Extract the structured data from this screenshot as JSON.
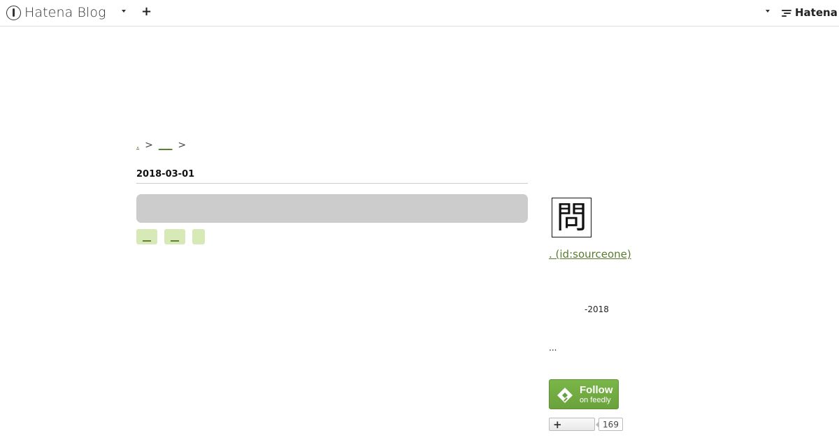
{
  "navbar": {
    "brand": "Hatena Blog",
    "add_icon": "plus-icon",
    "hatena": "Hatena"
  },
  "breadcrumb": {
    "home": ".",
    "separator": ">",
    "category": "___"
  },
  "entry": {
    "date": "2018-03-01",
    "tags": [
      "__",
      "__",
      ""
    ]
  },
  "sidebar": {
    "profile_icon_char": "問",
    "profile_link": ". (id:sourceone)",
    "year": "-2018",
    "ellipsis": "..."
  },
  "feedly": {
    "title": "Follow",
    "subtitle": "on feedly"
  },
  "bookmark": {
    "plus": "+",
    "count": "169"
  },
  "colors": {
    "link": "#587b2e",
    "tag_bg": "#d6e9b7",
    "feedly_green": "#6aa13c"
  }
}
